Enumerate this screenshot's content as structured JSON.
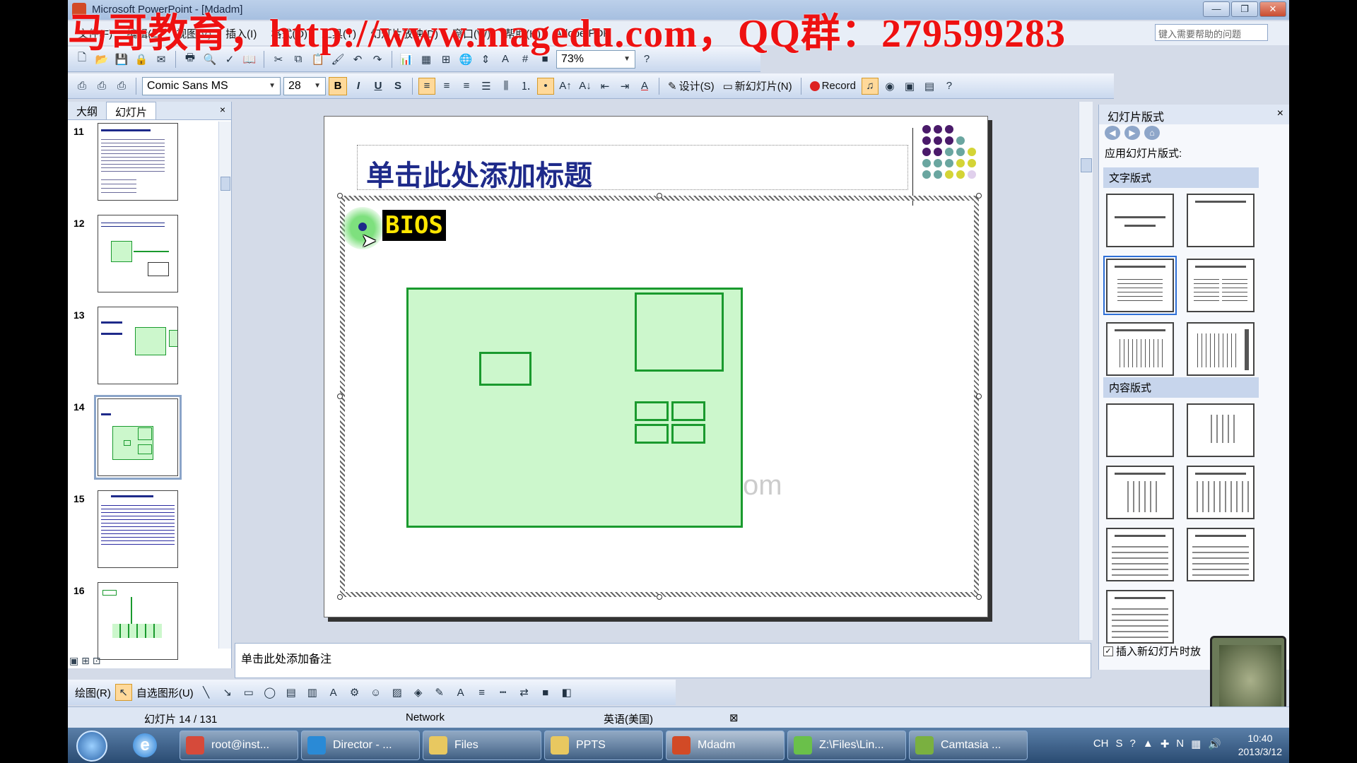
{
  "window": {
    "title": "Microsoft PowerPoint - [Mdadm]",
    "buttons": [
      "—",
      "❐",
      "✕"
    ]
  },
  "watermark": "马哥教育，http://www.magedu.com，QQ群：279599283",
  "menu": {
    "items": [
      "文件(F)",
      "编辑(E)",
      "视图(V)",
      "插入(I)",
      "格式(O)",
      "工具(T)",
      "幻灯片放映(D)",
      "窗口(W)",
      "帮助(H)",
      "Adobe PDF"
    ],
    "help_placeholder": "键入需要帮助的问题"
  },
  "toolbar_standard": {
    "zoom": "73%"
  },
  "toolbar_format": {
    "font": "Comic Sans MS",
    "size": "28",
    "bold": "B",
    "italic": "I",
    "underline": "U",
    "shadow": "S",
    "design": "设计(S)",
    "new_slide": "新幻灯片(N)",
    "record": "Record"
  },
  "left_pane": {
    "tabs": [
      "大纲",
      "幻灯片"
    ],
    "close": "×",
    "slides": [
      {
        "num": "11"
      },
      {
        "num": "12"
      },
      {
        "num": "13"
      },
      {
        "num": "14"
      },
      {
        "num": "15"
      },
      {
        "num": "16"
      }
    ]
  },
  "slide": {
    "title_placeholder": "单击此处添加标题",
    "bullet_text": "BIOS"
  },
  "notes": {
    "placeholder": "单击此处添加备注"
  },
  "task_pane": {
    "title": "幻灯片版式",
    "close": "×",
    "apply_label": "应用幻灯片版式:",
    "section_text": "文字版式",
    "section_content": "内容版式",
    "checkbox_label": "插入新幻灯片时放"
  },
  "draw_toolbar": {
    "draw": "绘图(R)",
    "autoshape": "自选图形(U)"
  },
  "status": {
    "slide_pos": "幻灯片 14 / 131",
    "design": "Network",
    "lang": "英语(美国)"
  },
  "taskbar": {
    "tasks": [
      "root@inst...",
      "Director - ...",
      "Files",
      "PPTS",
      "Mdadm",
      "Z:\\Files\\Lin...",
      "Camtasia ..."
    ],
    "lang": "CH",
    "time": "10:40",
    "date": "2013/3/12"
  },
  "colors": {
    "accent_green": "#1a9a2e",
    "board_fill": "#ccf7cc",
    "title_blue": "#1e2a8a",
    "watermark_red": "#ee1111"
  }
}
